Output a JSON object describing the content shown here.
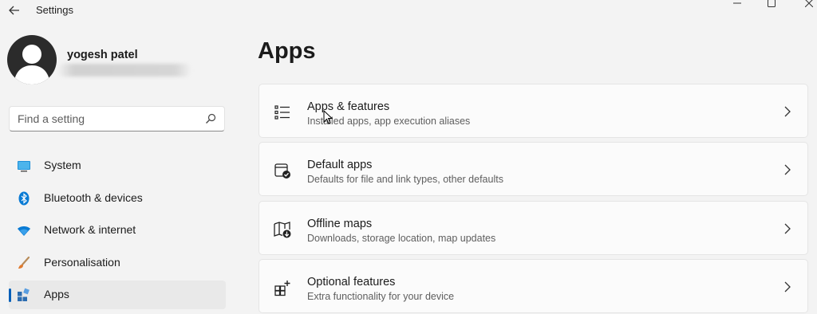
{
  "window": {
    "title": "Settings",
    "back_icon": "arrow-left-icon",
    "controls": [
      "minimize-icon",
      "maximize-icon",
      "close-icon"
    ]
  },
  "profile": {
    "name": "yogesh patel",
    "avatar_icon": "person-icon"
  },
  "search": {
    "placeholder": "Find a setting",
    "icon": "search-icon"
  },
  "nav": {
    "items": [
      {
        "label": "System",
        "icon": "monitor-icon",
        "selected": false
      },
      {
        "label": "Bluetooth & devices",
        "icon": "bluetooth-icon",
        "selected": false
      },
      {
        "label": "Network & internet",
        "icon": "wifi-icon",
        "selected": false
      },
      {
        "label": "Personalisation",
        "icon": "brush-icon",
        "selected": false
      },
      {
        "label": "Apps",
        "icon": "apps-icon",
        "selected": true
      }
    ]
  },
  "main": {
    "title": "Apps",
    "cards": [
      {
        "title": "Apps & features",
        "subtitle": "Installed apps, app execution aliases",
        "icon": "list-icon"
      },
      {
        "title": "Default apps",
        "subtitle": "Defaults for file and link types, other defaults",
        "icon": "default-apps-icon"
      },
      {
        "title": "Offline maps",
        "subtitle": "Downloads, storage location, map updates",
        "icon": "map-icon"
      },
      {
        "title": "Optional features",
        "subtitle": "Extra functionality for your device",
        "icon": "add-feature-icon"
      }
    ]
  },
  "colors": {
    "background": "#f3f3f3",
    "accent": "#005fb8",
    "card": "#fbfbfb"
  }
}
